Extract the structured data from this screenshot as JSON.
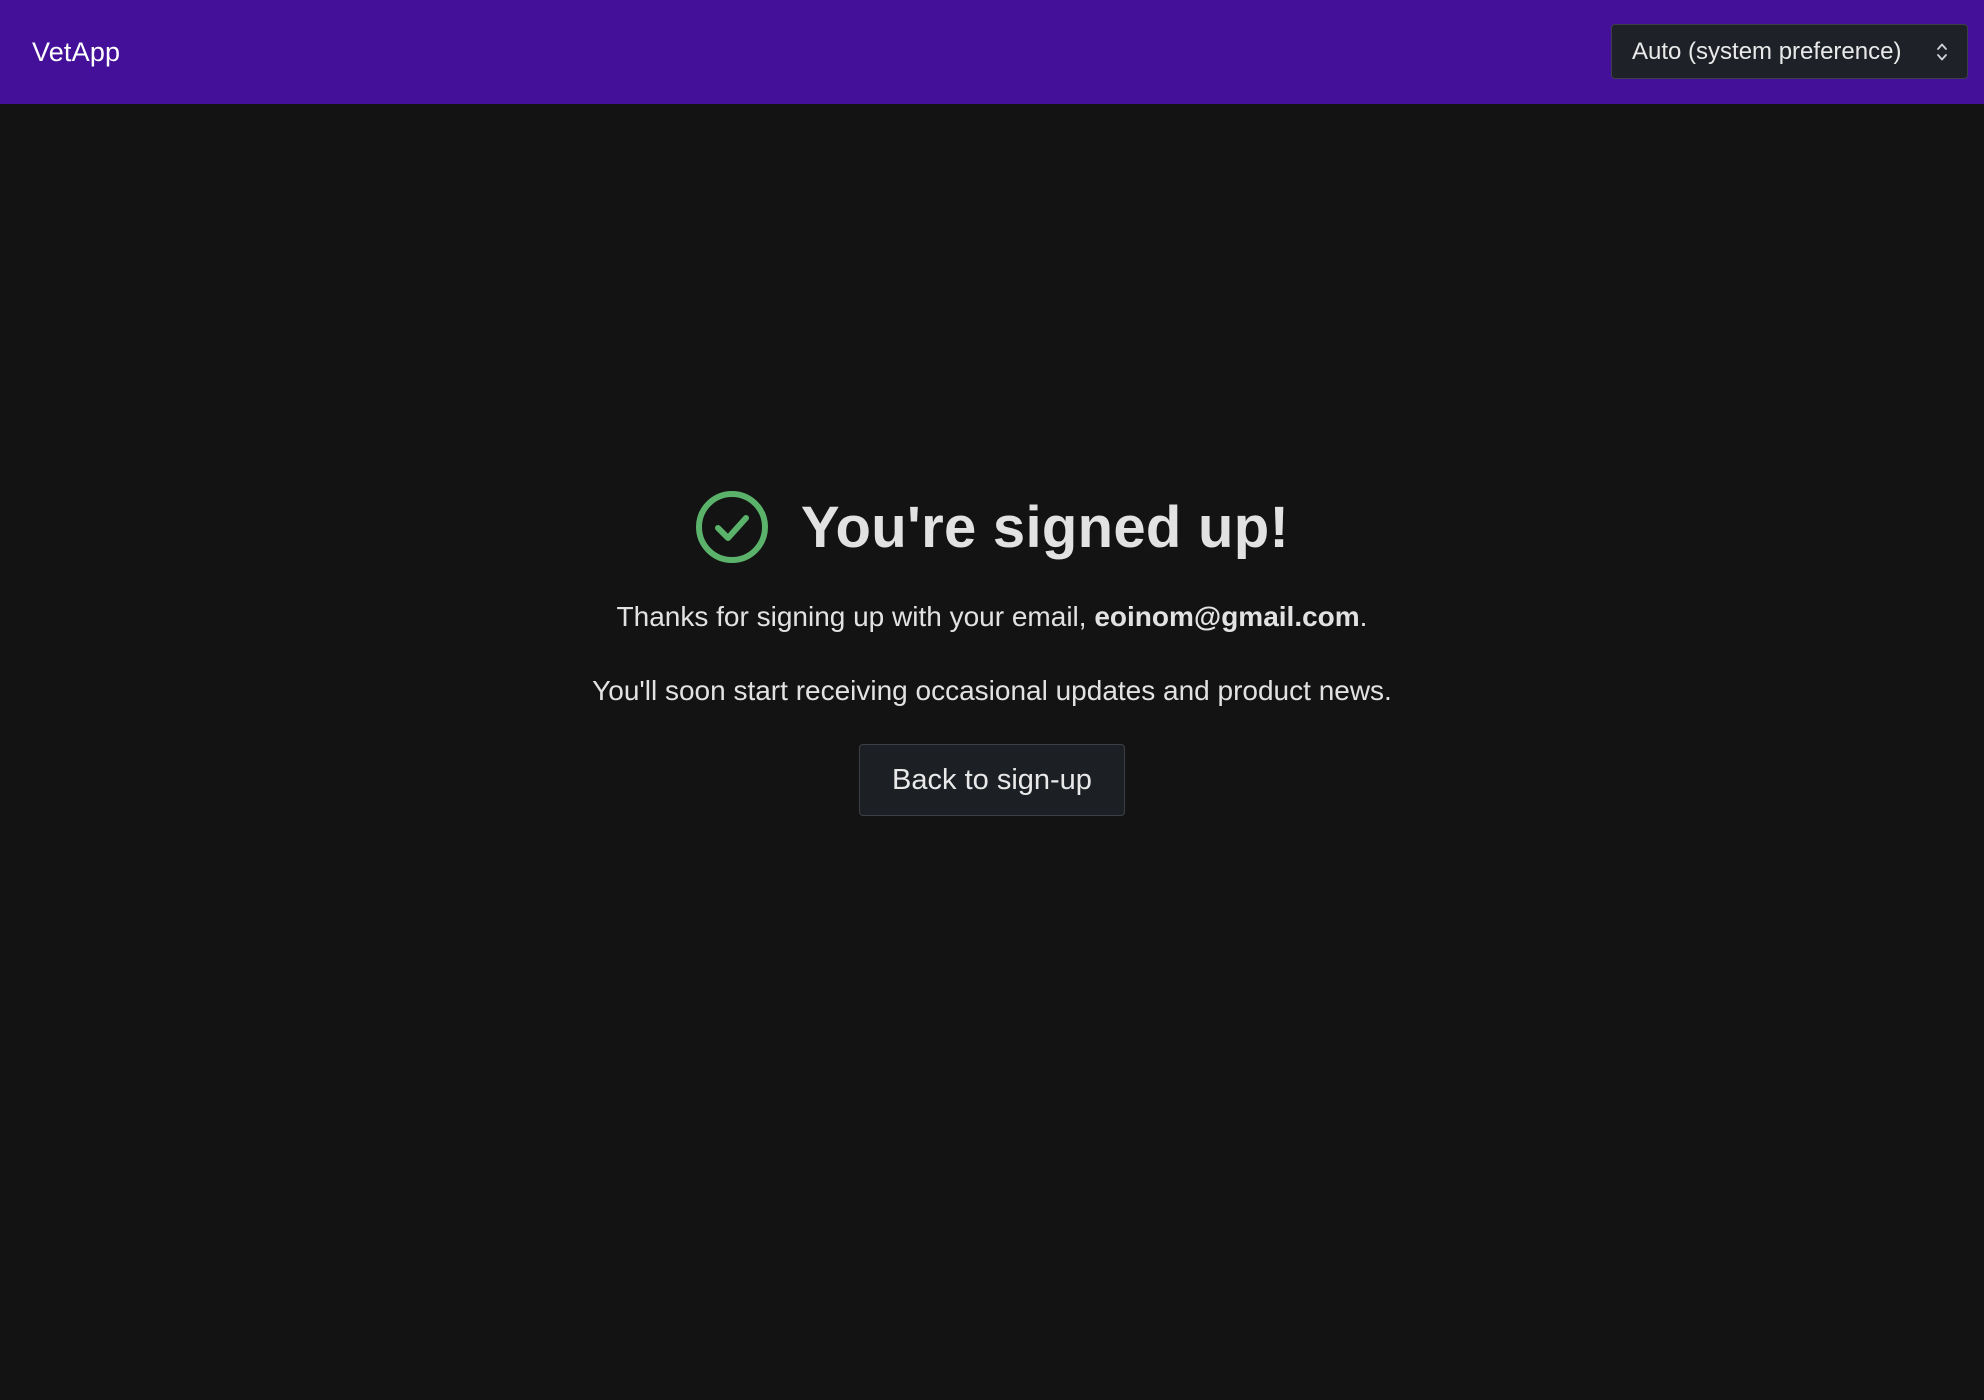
{
  "header": {
    "brand": "VetApp",
    "theme_select": {
      "selected": "Auto (system preference)",
      "icon": "chevron-up-down-icon"
    },
    "background_color": "#44109a"
  },
  "confirmation": {
    "icon": "check-circle-icon",
    "icon_color": "#5bb26a",
    "title": "You're signed up!",
    "thanks_prefix": "Thanks for signing up with your email, ",
    "email": "eoinom@gmail.com",
    "thanks_suffix": ".",
    "updates_text": "You'll soon start receiving occasional updates and product news.",
    "back_button_label": "Back to sign-up"
  }
}
